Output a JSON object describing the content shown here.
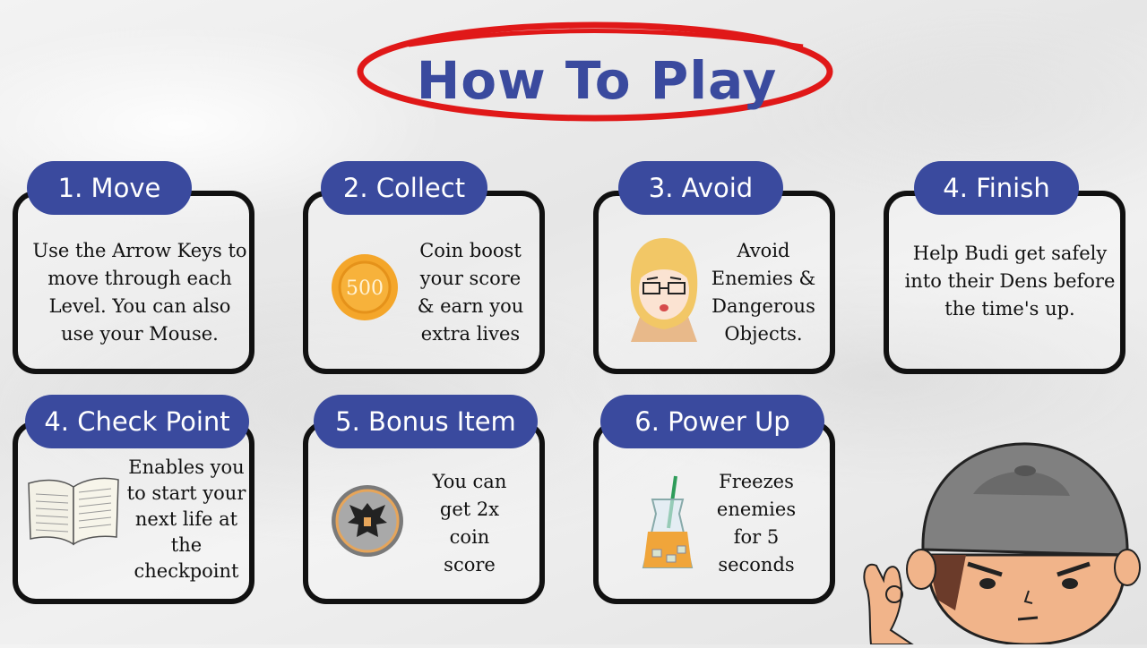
{
  "title": "How To Play",
  "colors": {
    "accent": "#3a4a9e",
    "outline": "#e01818",
    "border": "#111111"
  },
  "cards": [
    {
      "heading": "1. Move",
      "icon": "none",
      "text": "Use the Arrow Keys to move through each Level. You can also use your Mouse."
    },
    {
      "heading": "2. Collect",
      "icon": "coin-icon",
      "coin_value": "500",
      "text": "Coin boost your score & earn you extra lives"
    },
    {
      "heading": "3. Avoid",
      "icon": "enemy-girl-icon",
      "text": "Avoid Enemies & Dangerous Objects."
    },
    {
      "heading": "4. Finish",
      "icon": "none",
      "text": "Help Budi get safely into their Dens before the time's up."
    },
    {
      "heading": "4. Check Point",
      "icon": "book-icon",
      "text": "Enables you to start your next life at the checkpoint"
    },
    {
      "heading": "5. Bonus Item",
      "icon": "garuda-badge-icon",
      "text": "You can get 2x coin score"
    },
    {
      "heading": "6. Power Up",
      "icon": "iced-drink-icon",
      "text": "Freezes enemies for 5 seconds"
    }
  ],
  "mascot": "budi-character-icon"
}
